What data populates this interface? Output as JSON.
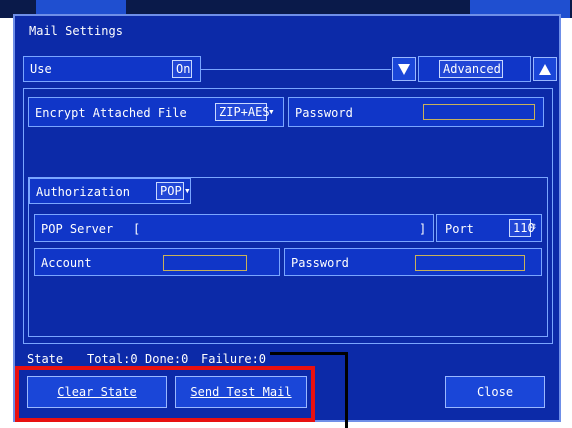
{
  "dialog": {
    "title": "Mail Settings"
  },
  "use": {
    "label": "Use",
    "value": "On",
    "advanced_label": "Advanced"
  },
  "encrypt": {
    "label": "Encrypt Attached File",
    "value": "ZIP+AES",
    "password_label": "Password",
    "password_value": ""
  },
  "authorization": {
    "label": "Authorization",
    "value": "POP"
  },
  "pop": {
    "server_label": "POP Server",
    "bracket_open": "[",
    "bracket_close": "]",
    "server_value": "",
    "port_label": "Port",
    "port_value": "110"
  },
  "account": {
    "label": "Account",
    "value": "",
    "password_label": "Password",
    "password_value": ""
  },
  "state": {
    "label": "State",
    "total": "Total:0",
    "done": "Done:0",
    "failure": "Failure:0"
  },
  "buttons": {
    "clear_state": "Clear State",
    "send_test_mail": "Send Test Mail",
    "close": "Close"
  },
  "colors": {
    "dialog_bg": "#0c2aa8",
    "highlight": "#e81010"
  },
  "icons": {
    "dropdown": "down-triangle",
    "collapse": "up-triangle",
    "spinner": "updown"
  }
}
